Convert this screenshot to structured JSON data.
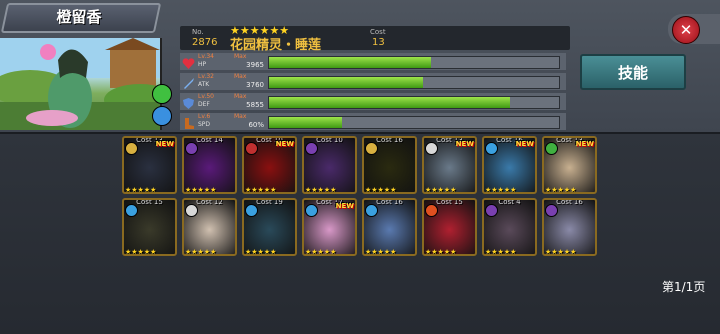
{
  "hero": {
    "name": "橙留香"
  },
  "unit": {
    "no_label": "No.",
    "no": "2876",
    "rarity_stars": "★★★★★★",
    "name": "花园精灵・睡莲",
    "cost_label": "Cost",
    "cost": "13"
  },
  "stats": [
    {
      "lv": "Lv.34",
      "label": "HP",
      "max": "Max",
      "value": "3965",
      "fill": 0.56,
      "color": "#e23040"
    },
    {
      "lv": "Lv.32",
      "label": "ATK",
      "max": "Max",
      "value": "3760",
      "fill": 0.53,
      "color": "#4a8ad8"
    },
    {
      "lv": "Lv.50",
      "label": "DEF",
      "max": "Max",
      "value": "5855",
      "fill": 0.83,
      "color": "#5a8ad8"
    },
    {
      "lv": "Lv.6",
      "label": "SPD",
      "max": "Max",
      "value": "60%",
      "fill": 0.25,
      "color": "#c86a20"
    }
  ],
  "skill_button": "技能",
  "close_button": "✕",
  "cards": [
    {
      "cost": "Cost 13",
      "new": "NEW",
      "element": "#d8b040",
      "bg": "#2a3040",
      "stars": "★★★★★"
    },
    {
      "cost": "Cost 14",
      "new": "",
      "element": "#7a40b0",
      "bg": "#5a1a7a",
      "stars": "★★★★★"
    },
    {
      "cost": "Cost 10",
      "new": "NEW",
      "element": "#c03030",
      "bg": "#8a1010",
      "stars": "★★★★★"
    },
    {
      "cost": "Cost 10",
      "new": "",
      "element": "#7a40b0",
      "bg": "#4a2a6a",
      "stars": "★★★★★"
    },
    {
      "cost": "Cost 16",
      "new": "",
      "element": "#d8b040",
      "bg": "#2a2a10",
      "stars": "★★★★★"
    },
    {
      "cost": "Cost 13",
      "new": "NEW",
      "element": "#d8d8d8",
      "bg": "#6a7a8a",
      "stars": "★★★★★"
    },
    {
      "cost": "Cost 16",
      "new": "NEW",
      "element": "#3aa0e0",
      "bg": "#3a7aaa",
      "stars": "★★★★★"
    },
    {
      "cost": "Cost 13",
      "new": "NEW",
      "element": "#40b040",
      "bg": "#c8b090",
      "stars": "★★★★★"
    },
    {
      "cost": "Cost 15",
      "new": "",
      "element": "#3aa0e0",
      "bg": "#3a3a2a",
      "stars": "★★★★★"
    },
    {
      "cost": "Cost 12",
      "new": "",
      "element": "#d8d8d8",
      "bg": "#d0c0b0",
      "stars": "★★★★★"
    },
    {
      "cost": "Cost 19",
      "new": "",
      "element": "#3aa0e0",
      "bg": "#2a4a5a",
      "stars": "★★★★★"
    },
    {
      "cost": "Cost 17",
      "new": "NEW",
      "element": "#3aa0e0",
      "bg": "#d898c8",
      "stars": "★★★★★"
    },
    {
      "cost": "Cost 16",
      "new": "",
      "element": "#3aa0e0",
      "bg": "#5a7ab0",
      "stars": "★★★★★"
    },
    {
      "cost": "Cost 15",
      "new": "",
      "element": "#e05020",
      "bg": "#b02030",
      "stars": "★★★★★"
    },
    {
      "cost": "Cost 4",
      "new": "",
      "element": "#7a40b0",
      "bg": "#5a4a5a",
      "stars": "★★★★★"
    },
    {
      "cost": "Cost 16",
      "new": "",
      "element": "#7a40b0",
      "bg": "#8a8aa8",
      "stars": "★★★★★"
    }
  ],
  "pagination": "第1/1页"
}
